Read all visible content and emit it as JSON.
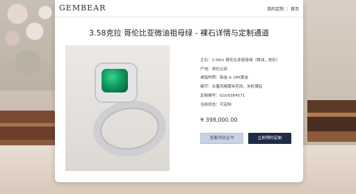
{
  "brand": {
    "logo": "GEMBEAR"
  },
  "nav": {
    "my_custom": "我的定制",
    "sep": "|",
    "home": "首页"
  },
  "page": {
    "title": "3.58克拉 哥伦比亚微油祖母绿 - 裸石详情与定制通道"
  },
  "product": {
    "specs": [
      "主石：3.58ct 哥伦比亚祖母绿（微油，枕形）",
      "产地：哥伦比亚",
      "戒指材质：铂金 & 18K黄金",
      "细节：古董风格蕾丝花纹，米粒镶钻",
      "定制编号：G109384571",
      "当前状态：可定制"
    ],
    "price": "¥ 398,000.00"
  },
  "actions": {
    "secondary_label": "查看项目证书",
    "primary_label": "立即预约定制"
  },
  "colors": {
    "primary_button": "#1e2c46",
    "secondary_button": "#c9d2e3",
    "gem": "#0e9a5e"
  }
}
